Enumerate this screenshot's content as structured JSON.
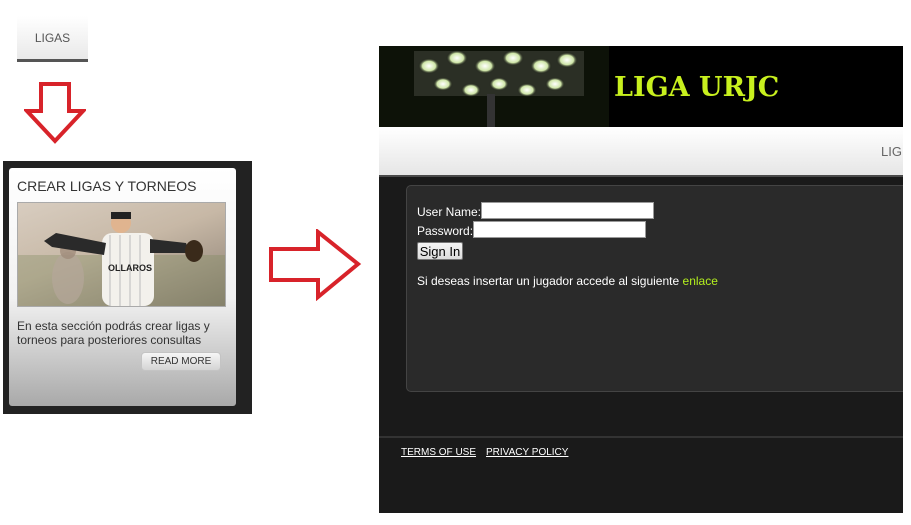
{
  "tab": {
    "label": "LIGAS"
  },
  "card": {
    "title": "CREAR LIGAS Y TORNEOS",
    "description": "En esta sección podrás crear ligas y torneos para posteriores consultas",
    "read_more_label": "READ MORE",
    "photo_jersey_text": "OLLAROS"
  },
  "site": {
    "logo": "LIGA URJC",
    "nav": {
      "partial_item": "LIG"
    },
    "login": {
      "username_label": "User Name:",
      "username_value": "",
      "password_label": "Password:",
      "password_value": "",
      "signin_label": "Sign In"
    },
    "info_text": "Si deseas insertar un jugador accede al siguiente",
    "link_label": "enlace",
    "footer": {
      "terms_label": "TERMS OF USE",
      "privacy_label": "PRIVACY POLICY"
    }
  },
  "colors": {
    "accent_green": "#c8f01e",
    "link_green": "#b4f01e",
    "arrow_red": "#d8232a",
    "dark_bg": "#1a1a1a"
  }
}
